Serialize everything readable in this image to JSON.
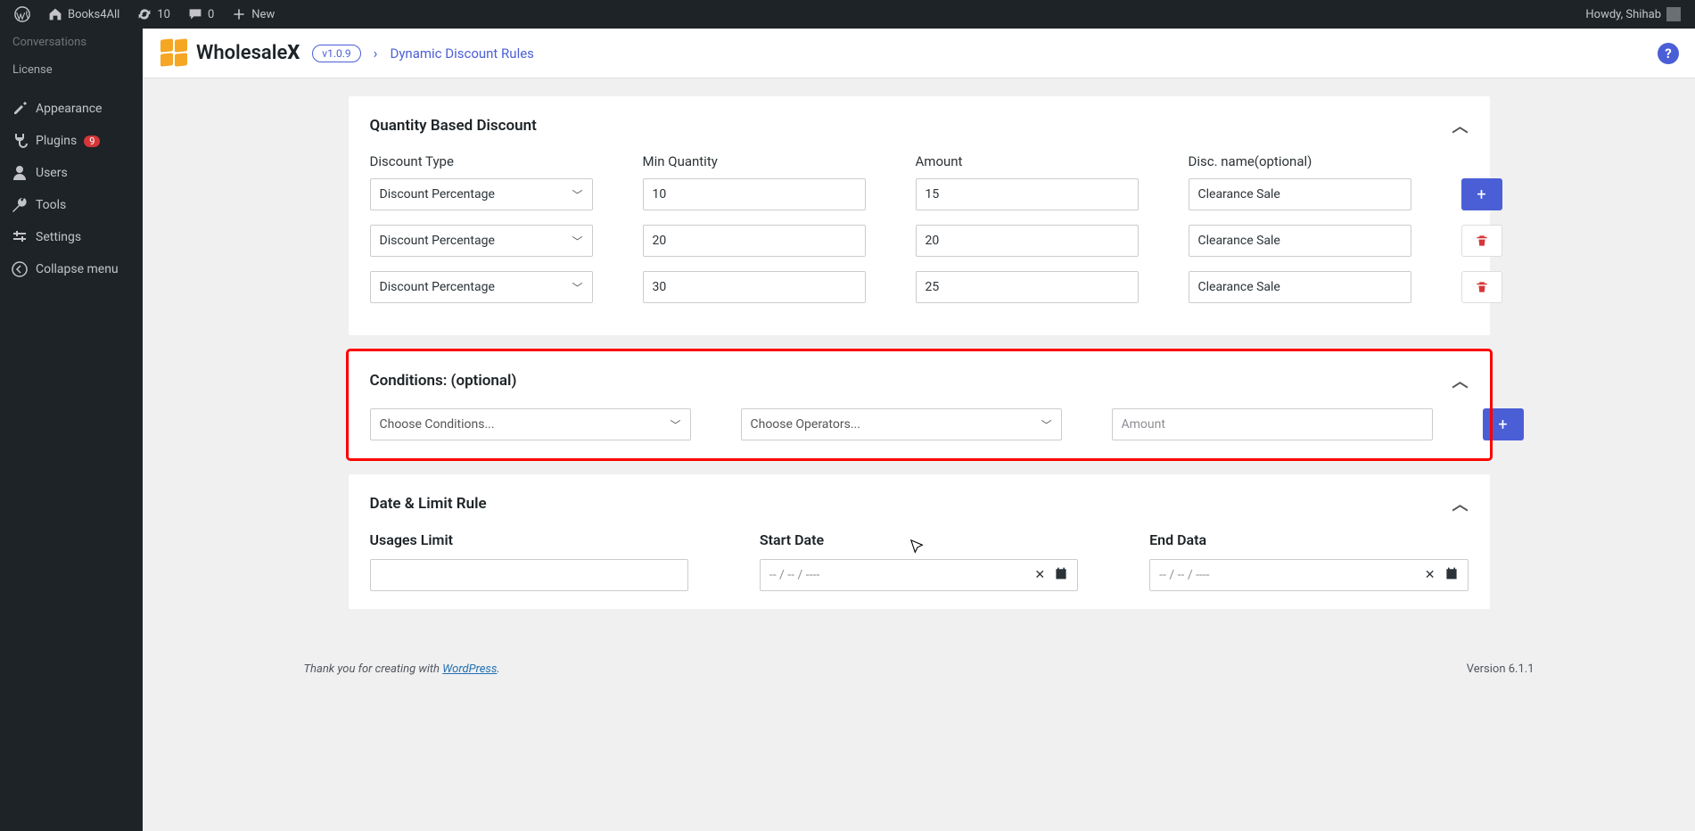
{
  "adminbar": {
    "site": "Books4All",
    "updates": "10",
    "comments": "0",
    "newLabel": "New",
    "howdy": "Howdy, Shihab"
  },
  "sidebar": {
    "conversations": "Conversations",
    "license": "License",
    "appearance": "Appearance",
    "plugins": "Plugins",
    "pluginsBadge": "9",
    "users": "Users",
    "tools": "Tools",
    "settings": "Settings",
    "collapse": "Collapse menu"
  },
  "topbar": {
    "brand1": "Wholesale",
    "brand2": "X",
    "version": "v1.0.9",
    "breadcrumb": "Dynamic Discount Rules"
  },
  "qty": {
    "title": "Quantity Based Discount",
    "colType": "Discount Type",
    "colMin": "Min Quantity",
    "colAmount": "Amount",
    "colName": "Disc. name(optional)",
    "rows": [
      {
        "type": "Discount Percentage",
        "min": "10",
        "amount": "15",
        "name": "Clearance Sale"
      },
      {
        "type": "Discount Percentage",
        "min": "20",
        "amount": "20",
        "name": "Clearance Sale"
      },
      {
        "type": "Discount Percentage",
        "min": "30",
        "amount": "25",
        "name": "Clearance Sale"
      }
    ]
  },
  "cond": {
    "title": "Conditions: (optional)",
    "choose": "Choose Conditions...",
    "operators": "Choose Operators...",
    "amountPh": "Amount"
  },
  "date": {
    "title": "Date & Limit Rule",
    "usages": "Usages Limit",
    "start": "Start Date",
    "end": "End Data",
    "placeholder": "--  /  --  /  ----"
  },
  "footer": {
    "thanks": "Thank you for creating with ",
    "wp": "WordPress",
    "version": "Version 6.1.1"
  }
}
